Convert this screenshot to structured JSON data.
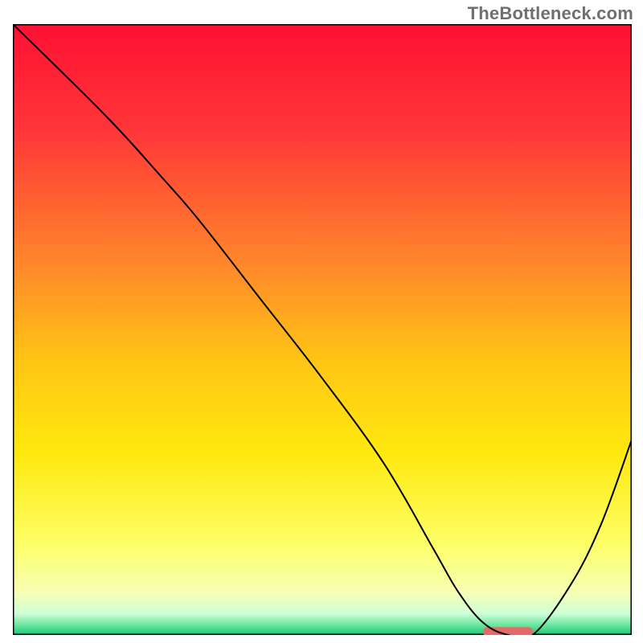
{
  "watermark": "TheBottleneck.com",
  "chart_data": {
    "type": "line",
    "title": "",
    "xlabel": "",
    "ylabel": "",
    "xlim": [
      0,
      100
    ],
    "ylim": [
      0,
      100
    ],
    "axes": {
      "top": true,
      "bottom": true,
      "left": true,
      "right": true,
      "ticks": false,
      "tick_labels": false,
      "grid": false
    },
    "background": {
      "type": "vertical-gradient",
      "stops": [
        {
          "pos": 0.0,
          "color": "#ff1033"
        },
        {
          "pos": 0.18,
          "color": "#ff3838"
        },
        {
          "pos": 0.4,
          "color": "#ff8a2a"
        },
        {
          "pos": 0.55,
          "color": "#ffc515"
        },
        {
          "pos": 0.7,
          "color": "#ffe80e"
        },
        {
          "pos": 0.85,
          "color": "#fdff66"
        },
        {
          "pos": 0.93,
          "color": "#f6ffb3"
        },
        {
          "pos": 0.965,
          "color": "#cfffd8"
        },
        {
          "pos": 0.985,
          "color": "#63e49b"
        },
        {
          "pos": 1.0,
          "color": "#17c877"
        }
      ]
    },
    "series": [
      {
        "name": "bottleneck-curve",
        "color": "#000000",
        "stroke_width": 2,
        "x": [
          0,
          15,
          24,
          30,
          40,
          50,
          60,
          68,
          72,
          76,
          80,
          84,
          90,
          95,
          100
        ],
        "values": [
          100,
          85,
          75,
          68,
          55,
          42,
          28,
          14,
          7,
          2,
          0,
          0,
          8,
          18,
          32
        ]
      }
    ],
    "markers": [
      {
        "name": "optimal-spot",
        "type": "rounded-bar",
        "x_start": 76,
        "x_end": 84,
        "y": 0.5,
        "color": "#e46a6a"
      }
    ]
  }
}
